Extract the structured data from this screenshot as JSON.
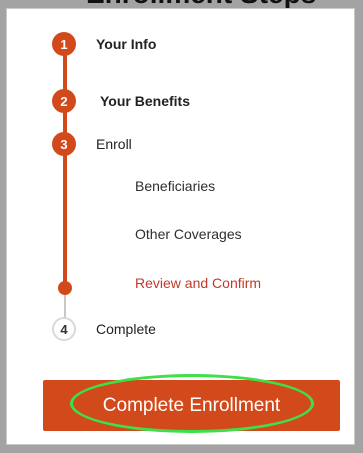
{
  "header": {
    "title": "Enrollment Steps"
  },
  "steps": [
    {
      "number": "1",
      "label": "Your Info",
      "state": "complete"
    },
    {
      "number": "2",
      "label": "Your Benefits",
      "state": "complete"
    },
    {
      "number": "3",
      "label": "Enroll",
      "state": "current"
    },
    {
      "number": "4",
      "label": "Complete",
      "state": "upcoming"
    }
  ],
  "substeps": [
    {
      "label": "Beneficiaries",
      "state": "done"
    },
    {
      "label": "Other Coverages",
      "state": "done"
    },
    {
      "label": "Review and Confirm",
      "state": "current"
    }
  ],
  "actions": {
    "primary_label": "Complete Enrollment"
  },
  "colors": {
    "accent": "#d24a1c",
    "current_substep_text": "#c0392b",
    "highlight_ring": "#3ee04a",
    "upcoming_circle_border": "#d9d9d9"
  }
}
